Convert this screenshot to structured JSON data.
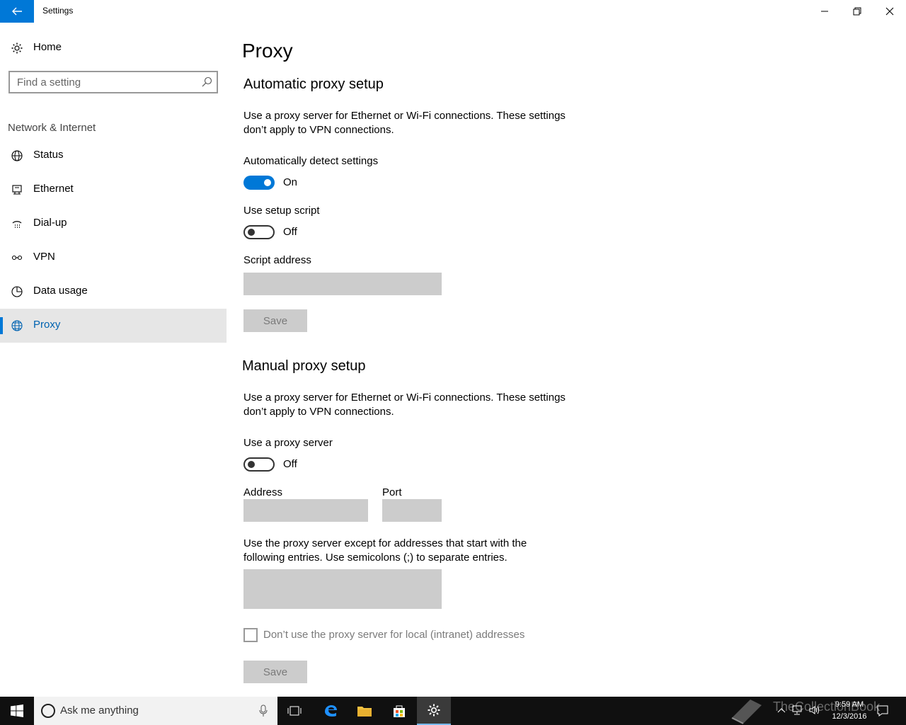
{
  "window": {
    "title": "Settings"
  },
  "sidebar": {
    "home_label": "Home",
    "search_placeholder": "Find a setting",
    "section_title": "Network & Internet",
    "items": [
      {
        "label": "Status",
        "icon": "globe-status-icon"
      },
      {
        "label": "Ethernet",
        "icon": "ethernet-icon"
      },
      {
        "label": "Dial-up",
        "icon": "dialup-icon"
      },
      {
        "label": "VPN",
        "icon": "vpn-icon"
      },
      {
        "label": "Data usage",
        "icon": "data-usage-icon"
      },
      {
        "label": "Proxy",
        "icon": "globe-icon",
        "selected": true
      }
    ]
  },
  "main": {
    "page_title": "Proxy",
    "auto": {
      "heading": "Automatic proxy setup",
      "description": "Use a proxy server for Ethernet or Wi-Fi connections. These settings don’t apply to VPN connections.",
      "detect_label": "Automatically detect settings",
      "detect_state": "On",
      "script_label": "Use setup script",
      "script_state": "Off",
      "script_address_label": "Script address",
      "script_address_value": "",
      "save_label": "Save"
    },
    "manual": {
      "heading": "Manual proxy setup",
      "description": "Use a proxy server for Ethernet or Wi-Fi connections. These settings don’t apply to VPN connections.",
      "use_proxy_label": "Use a proxy server",
      "use_proxy_state": "Off",
      "address_label": "Address",
      "address_value": "",
      "port_label": "Port",
      "port_value": "",
      "exceptions_description": "Use the proxy server except for addresses that start with the following entries. Use semicolons (;) to separate entries.",
      "exceptions_value": "",
      "local_checkbox_label": "Don’t use the proxy server for local (intranet) addresses",
      "save_label": "Save"
    }
  },
  "taskbar": {
    "search_placeholder": "Ask me anything",
    "time": "9:59 AM",
    "date": "12/3/2016",
    "watermark": "TheCollectionBook"
  },
  "colors": {
    "accent": "#0078d7",
    "selected_bg": "#e6e6e6",
    "disabled_field": "#cccccc",
    "taskbar": "#101010"
  }
}
